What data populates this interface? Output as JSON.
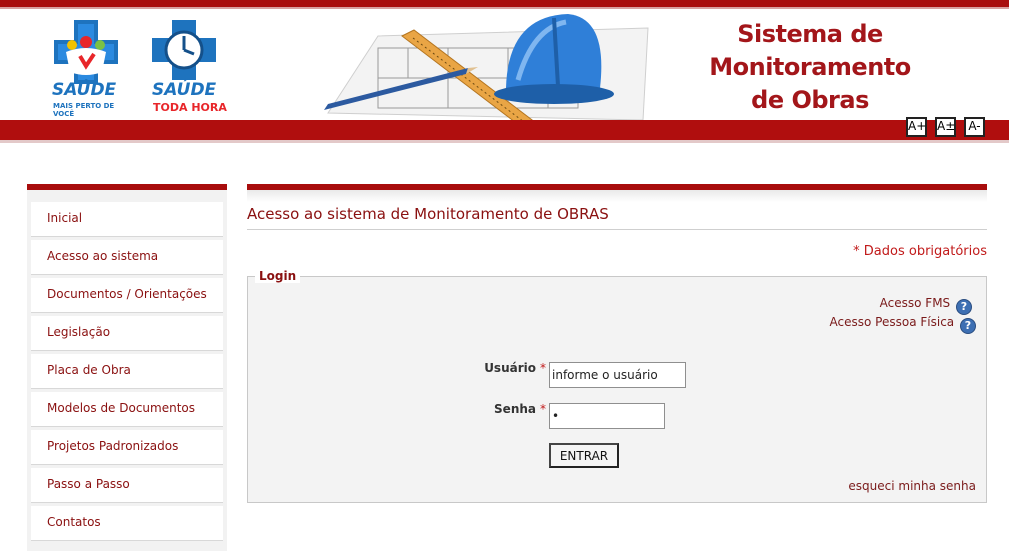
{
  "header": {
    "title_line1": "Sistema de",
    "title_line2": "Monitoramento",
    "title_line3": "de Obras",
    "logo1": {
      "name": "SAÚDE",
      "tagline": "MAIS PERTO DE VOCÊ"
    },
    "logo2": {
      "name": "SAÚDE",
      "tagline": "TODA HORA"
    },
    "font_buttons": [
      "A+",
      "A±",
      "A-"
    ],
    "colors": {
      "brand_red": "#a80d0d",
      "title_red": "#a3161a",
      "icon_blue": "#3d6fb3"
    }
  },
  "sidebar": {
    "items": [
      {
        "label": "Inicial"
      },
      {
        "label": "Acesso ao sistema"
      },
      {
        "label": "Documentos / Orientações"
      },
      {
        "label": "Legislação"
      },
      {
        "label": "Placa de Obra"
      },
      {
        "label": "Modelos de Documentos"
      },
      {
        "label": "Projetos Padronizados"
      },
      {
        "label": "Passo a Passo"
      },
      {
        "label": "Contatos"
      }
    ]
  },
  "main": {
    "page_title": "Acesso ao sistema de Monitoramento de OBRAS",
    "required_note": "* Dados obrigatórios",
    "login": {
      "legend": "Login",
      "access_fms": "Acesso FMS",
      "access_pf": "Acesso Pessoa Física",
      "help_icon": "?",
      "user_label": "Usuário",
      "user_value": "informe o usuário",
      "password_label": "Senha",
      "password_value": "•",
      "required_star": "*",
      "submit_label": "ENTRAR",
      "forgot_label": "esqueci minha senha"
    }
  }
}
